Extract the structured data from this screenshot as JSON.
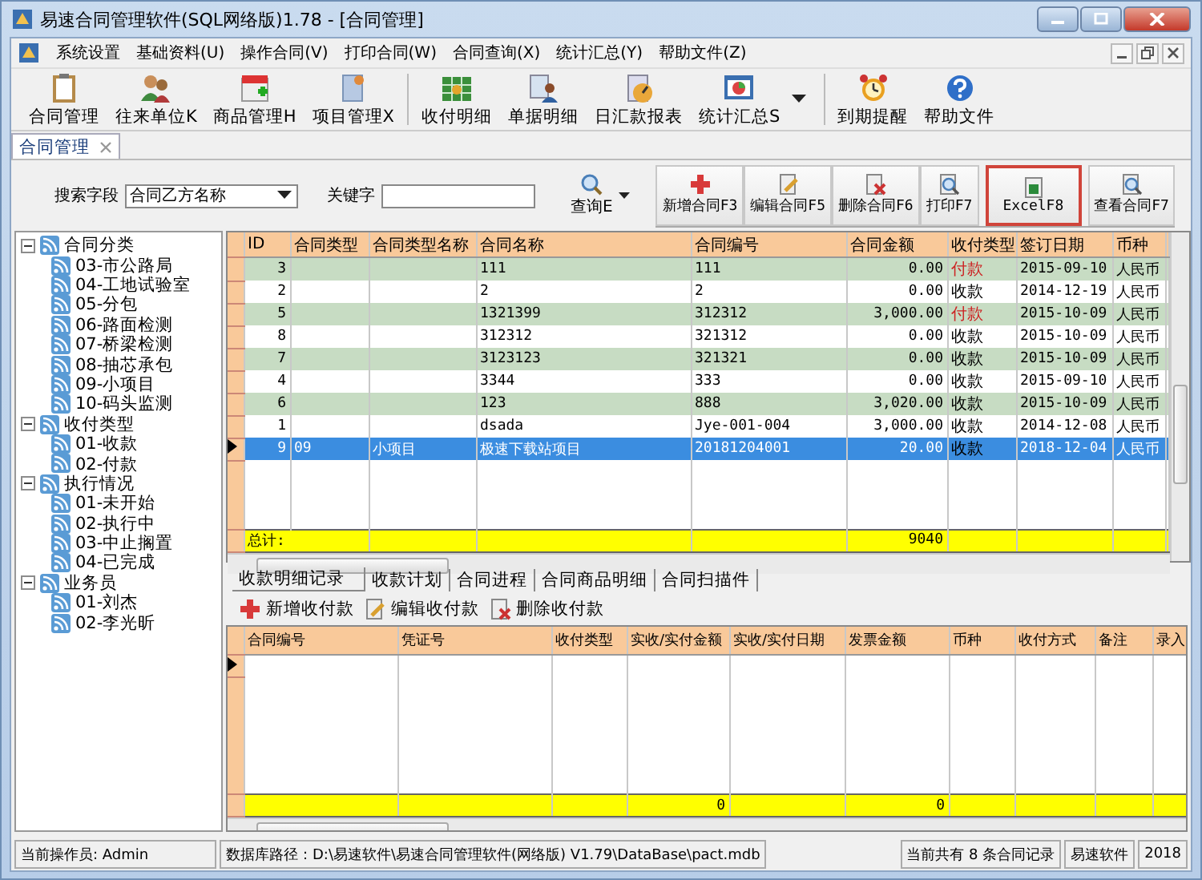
{
  "window": {
    "title": "易速合同管理软件(SQL网络版)1.78 - [合同管理]"
  },
  "menu": [
    "系统设置",
    "基础资料(U)",
    "操作合同(V)",
    "打印合同(W)",
    "合同查询(X)",
    "统计汇总(Y)",
    "帮助文件(Z)"
  ],
  "toolbar": [
    {
      "label": "合同管理"
    },
    {
      "label": "往来单位K"
    },
    {
      "label": "商品管理H"
    },
    {
      "label": "项目管理X"
    },
    {
      "label": "收付明细"
    },
    {
      "label": "单据明细"
    },
    {
      "label": "日汇款报表"
    },
    {
      "label": "统计汇总S",
      "dropdown": true
    },
    {
      "label": "到期提醒"
    },
    {
      "label": "帮助文件"
    }
  ],
  "doc_tabs": [
    {
      "label": "合同管理",
      "selected": true
    }
  ],
  "search": {
    "field_label": "搜索字段",
    "field_value": "合同乙方名称",
    "keyword_label": "关键字",
    "query_button": "查询E"
  },
  "actions": [
    {
      "label": "新增合同F3",
      "highlighted": false
    },
    {
      "label": "编辑合同F5",
      "highlighted": false
    },
    {
      "label": "删除合同F6",
      "highlighted": false
    },
    {
      "label": "打印F7",
      "highlighted": false
    },
    {
      "label": "ExcelF8",
      "highlighted": true
    },
    {
      "label": "查看合同F7",
      "highlighted": false
    }
  ],
  "tree": [
    {
      "label": "合同分类",
      "expanded": true,
      "children": [
        {
          "label": "03-市公路局"
        },
        {
          "label": "04-工地试验室"
        },
        {
          "label": "05-分包"
        },
        {
          "label": "06-路面检测"
        },
        {
          "label": "07-桥梁检测"
        },
        {
          "label": "08-抽芯承包"
        },
        {
          "label": "09-小项目"
        },
        {
          "label": "10-码头监测"
        }
      ]
    },
    {
      "label": "收付类型",
      "expanded": true,
      "children": [
        {
          "label": "01-收款"
        },
        {
          "label": "02-付款"
        }
      ]
    },
    {
      "label": "执行情况",
      "expanded": true,
      "children": [
        {
          "label": "01-未开始"
        },
        {
          "label": "02-执行中"
        },
        {
          "label": "03-中止搁置"
        },
        {
          "label": "04-已完成"
        }
      ]
    },
    {
      "label": "业务员",
      "expanded": true,
      "children": [
        {
          "label": "01-刘杰"
        },
        {
          "label": "02-李光昕"
        }
      ]
    }
  ],
  "table": {
    "columns": [
      "ID",
      "合同类型",
      "合同类型名称",
      "合同名称",
      "合同编号",
      "合同金额",
      "收付类型",
      "签订日期",
      "币种"
    ],
    "rows": [
      {
        "id": "3",
        "type": "",
        "type_name": "",
        "name": "111",
        "number": "111",
        "amount": "0.00",
        "pay_type": "付款",
        "color": "#cc2222",
        "date": "2015-09-10",
        "currency": "人民币",
        "selected": false
      },
      {
        "id": "2",
        "type": "",
        "type_name": "",
        "name": "2",
        "number": "2",
        "amount": "0.00",
        "pay_type": "收款",
        "color": "#000000",
        "date": "2014-12-19",
        "currency": "人民币",
        "selected": false
      },
      {
        "id": "5",
        "type": "",
        "type_name": "",
        "name": "1321399",
        "number": "312312",
        "amount": "3,000.00",
        "pay_type": "付款",
        "color": "#cc2222",
        "date": "2015-10-09",
        "currency": "人民币",
        "selected": false
      },
      {
        "id": "8",
        "type": "",
        "type_name": "",
        "name": "312312",
        "number": "321312",
        "amount": "0.00",
        "pay_type": "收款",
        "color": "#000000",
        "date": "2015-10-09",
        "currency": "人民币",
        "selected": false
      },
      {
        "id": "7",
        "type": "",
        "type_name": "",
        "name": "3123123",
        "number": "321321",
        "amount": "0.00",
        "pay_type": "收款",
        "color": "#000000",
        "date": "2015-10-09",
        "currency": "人民币",
        "selected": false
      },
      {
        "id": "4",
        "type": "",
        "type_name": "",
        "name": "3344",
        "number": "333",
        "amount": "0.00",
        "pay_type": "收款",
        "color": "#000000",
        "date": "2015-09-10",
        "currency": "人民币",
        "selected": false
      },
      {
        "id": "6",
        "type": "",
        "type_name": "",
        "name": "123",
        "number": "888",
        "amount": "3,020.00",
        "pay_type": "收款",
        "color": "#000000",
        "date": "2015-10-09",
        "currency": "人民币",
        "selected": false
      },
      {
        "id": "1",
        "type": "",
        "type_name": "",
        "name": "dsada",
        "number": "Jye-001-004",
        "amount": "3,000.00",
        "pay_type": "收款",
        "color": "#000000",
        "date": "2014-12-08",
        "currency": "人民币",
        "selected": false
      },
      {
        "id": "9",
        "type": "09",
        "type_name": "小项目",
        "name": "极速下载站项目",
        "number": "20181204001",
        "amount": "20.00",
        "pay_type": "收款",
        "color": "#000000",
        "date": "2018-12-04",
        "currency": "人民币",
        "selected": true
      }
    ],
    "total_label": "总计:",
    "total_amount": "9040"
  },
  "detail_tabs": [
    {
      "label": "收款明细记录",
      "selected": true
    },
    {
      "label": "收款计划",
      "selected": false
    },
    {
      "label": "合同进程",
      "selected": false
    },
    {
      "label": "合同商品明细",
      "selected": false
    },
    {
      "label": "合同扫描件",
      "selected": false
    }
  ],
  "detail_actions": [
    "新增收付款",
    "编辑收付款",
    "删除收付款"
  ],
  "detail_table": {
    "columns": [
      "合同编号",
      "凭证号",
      "收付类型",
      "实收/实付金额",
      "实收/实付日期",
      "发票金额",
      "币种",
      "收付方式",
      "备注",
      "录入"
    ],
    "total_amount": "0",
    "total_invoice": "0"
  },
  "status_bar": {
    "operator": "当前操作员: Admin",
    "db_path": "数据库路径：D:\\易速软件\\易速合同管理软件(网络版) V1.79\\DataBase\\pact.mdb",
    "count": "当前共有 8 条合同记录",
    "company": "易速软件",
    "date": "2018"
  }
}
